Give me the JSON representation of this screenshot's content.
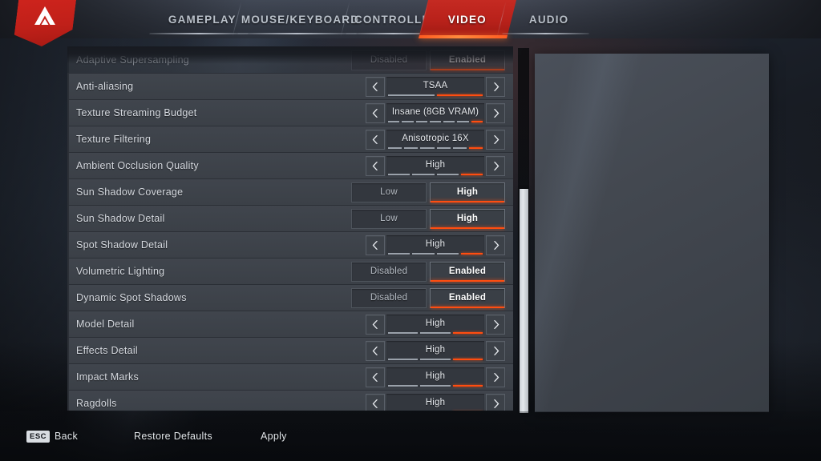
{
  "brand": {
    "logo_icon": "apex-legends-logo",
    "accent": "#ff4d10",
    "red": "#c52a22"
  },
  "tabs": [
    {
      "id": "gameplay",
      "label": "GAMEPLAY",
      "active": false
    },
    {
      "id": "mouse-keyboard",
      "label": "MOUSE/KEYBOARD",
      "active": false
    },
    {
      "id": "controller",
      "label": "CONTROLLER",
      "active": false
    },
    {
      "id": "video",
      "label": "VIDEO",
      "active": true
    },
    {
      "id": "audio",
      "label": "AUDIO",
      "active": false
    }
  ],
  "settings": [
    {
      "id": "adaptive-supersampling",
      "label": "Adaptive Supersampling",
      "type": "toggle",
      "clipped": true,
      "options": [
        "Disabled",
        "Enabled"
      ],
      "value": "Enabled"
    },
    {
      "id": "anti-aliasing",
      "label": "Anti-aliasing",
      "type": "stepper",
      "value": "TSAA",
      "steps": 2,
      "step_index": 2
    },
    {
      "id": "texture-streaming-budget",
      "label": "Texture Streaming Budget",
      "type": "stepper",
      "value": "Insane (8GB VRAM)",
      "steps": 7,
      "step_index": 7
    },
    {
      "id": "texture-filtering",
      "label": "Texture Filtering",
      "type": "stepper",
      "value": "Anisotropic 16X",
      "steps": 6,
      "step_index": 6
    },
    {
      "id": "ambient-occlusion-quality",
      "label": "Ambient Occlusion Quality",
      "type": "stepper",
      "value": "High",
      "steps": 4,
      "step_index": 4
    },
    {
      "id": "sun-shadow-coverage",
      "label": "Sun Shadow Coverage",
      "type": "toggle",
      "options": [
        "Low",
        "High"
      ],
      "value": "High"
    },
    {
      "id": "sun-shadow-detail",
      "label": "Sun Shadow Detail",
      "type": "toggle",
      "options": [
        "Low",
        "High"
      ],
      "value": "High"
    },
    {
      "id": "spot-shadow-detail",
      "label": "Spot Shadow Detail",
      "type": "stepper",
      "value": "High",
      "steps": 4,
      "step_index": 4
    },
    {
      "id": "volumetric-lighting",
      "label": "Volumetric Lighting",
      "type": "toggle",
      "options": [
        "Disabled",
        "Enabled"
      ],
      "value": "Enabled"
    },
    {
      "id": "dynamic-spot-shadows",
      "label": "Dynamic Spot Shadows",
      "type": "toggle",
      "options": [
        "Disabled",
        "Enabled"
      ],
      "value": "Enabled"
    },
    {
      "id": "model-detail",
      "label": "Model Detail",
      "type": "stepper",
      "value": "High",
      "steps": 3,
      "step_index": 3
    },
    {
      "id": "effects-detail",
      "label": "Effects Detail",
      "type": "stepper",
      "value": "High",
      "steps": 3,
      "step_index": 3
    },
    {
      "id": "impact-marks",
      "label": "Impact Marks",
      "type": "stepper",
      "value": "High",
      "steps": 3,
      "step_index": 3
    },
    {
      "id": "ragdolls",
      "label": "Ragdolls",
      "type": "stepper",
      "value": "High",
      "steps": 3,
      "step_index": 3
    }
  ],
  "footer": {
    "back": {
      "key": "ESC",
      "label": "Back"
    },
    "restore_defaults": "Restore Defaults",
    "apply": "Apply"
  },
  "scrollbar": {
    "orientation": "vertical",
    "thumb_top_pct": 39,
    "thumb_height_pct": 61
  }
}
